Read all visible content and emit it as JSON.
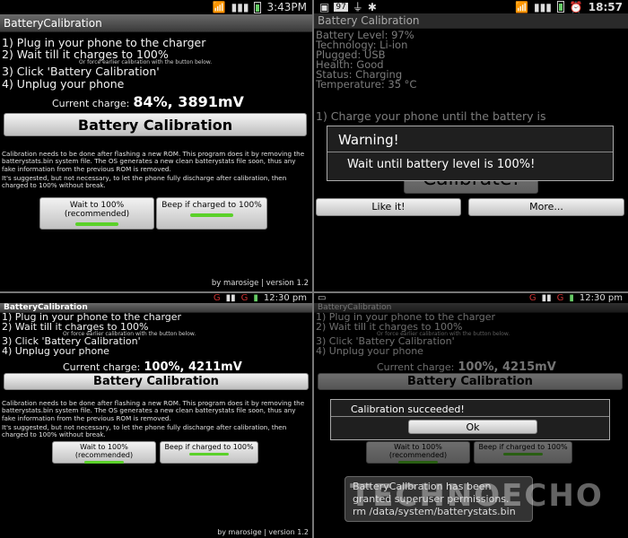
{
  "p1": {
    "status_time": "3:43PM",
    "title": "BatteryCalibration",
    "steps": [
      "1) Plug in your phone to the charger",
      "2) Wait till it charges to 100%",
      "3) Click 'Battery Calibration'",
      "4) Unplug your phone"
    ],
    "force_note": "Or force earlier calibration with the button below.",
    "charge_label": "Current charge:",
    "charge_value": "84%, 3891mV",
    "calibrate_label": "Battery Calibration",
    "para1": "Calibration needs to be done after flashing a new ROM. This program does it by removing the batterystats.bin system file. The OS generates a new clean batterystats file soon, thus any fake information from the previous ROM is removed.",
    "para2": "It's suggested, but not necessary, to let the phone fully discharge after calibration, then charged to 100% without break.",
    "wait_button": "Wait to 100% (recommended)",
    "beep_button": "Beep if charged to 100%",
    "footer": "by marosige | version 1.2"
  },
  "p2": {
    "status_badge": "97",
    "status_time": "18:57",
    "title": "Battery Calibration",
    "info": [
      "Battery Level: 97%",
      "Technology: Li-ion",
      "Plugged: USB",
      "Health: Good",
      "Status: Charging",
      "Temperature: 35 °C"
    ],
    "step1": "1) Charge your phone until the battery is",
    "calibrate_label": "Calibrate!",
    "like_button": "Like it!",
    "more_button": "More...",
    "dialog_title": "Warning!",
    "dialog_message": "Wait until battery level is 100%!"
  },
  "p3": {
    "status_time": "12:30 pm",
    "title": "BatteryCalibration",
    "steps": [
      "1) Plug in your phone to the charger",
      "2) Wait till it charges to 100%",
      "3) Click 'Battery Calibration'",
      "4) Unplug your phone"
    ],
    "force_note": "Or force earlier calibration with the button below.",
    "charge_label": "Current charge:",
    "charge_value": "100%, 4211mV",
    "calibrate_label": "Battery Calibration",
    "para1": "Calibration needs to be done after flashing a new ROM. This program does it by removing the batterystats.bin system file. The OS generates a new clean batterystats file soon, thus any fake information from the previous ROM is removed.",
    "para2": "It's suggested, but not necessary, to let the phone fully discharge after calibration, then charged to 100% without break.",
    "wait_button": "Wait to 100% (recommended)",
    "beep_button": "Beep if charged to 100%",
    "footer": "by marosige | version 1.2"
  },
  "p4": {
    "status_time": "12:30 pm",
    "title": "BatteryCalibration",
    "steps": [
      "1) Plug in your phone to the charger",
      "2) Wait till it charges to 100%",
      "3) Click 'Battery Calibration'",
      "4) Unplug your phone"
    ],
    "force_note": "Or force earlier calibration with the button below.",
    "charge_label": "Current charge:",
    "charge_value": "100%, 4215mV",
    "calibrate_label": "Battery Calibration",
    "wait_button": "Wait to 100% (recommended)",
    "beep_button": "Beep if charged to 100%",
    "dialog_title": "Calibration succeeded!",
    "ok_button": "Ok",
    "toast": "BatteryCalibration has been granted superuser permissions. rm /data/system/batterystats.bin",
    "watermark": "TECHNOECHO"
  }
}
